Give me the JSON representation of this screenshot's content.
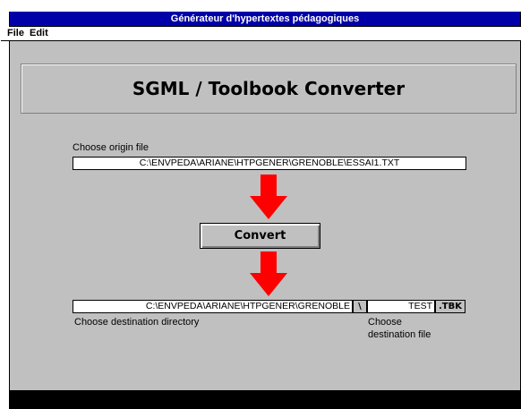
{
  "window": {
    "title": "Générateur d'hypertextes pédagogiques"
  },
  "menu": {
    "file": "File",
    "edit": "Edit"
  },
  "header": {
    "title": "SGML / Toolbook Converter"
  },
  "origin": {
    "label": "Choose origin file",
    "value": "C:\\ENVPEDA\\ARIANE\\HTPGENER\\GRENOBLE\\ESSAI1.TXT"
  },
  "convert": {
    "label": "Convert"
  },
  "destination": {
    "directory_value": "C:\\ENVPEDA\\ARIANE\\HTPGENER\\GRENOBLE",
    "separator": "\\",
    "file_value": "TEST",
    "extension": ".TBK",
    "directory_label": "Choose destination directory",
    "file_label_line1": "Choose",
    "file_label_line2": "destination file"
  },
  "colors": {
    "titlebar": "#0000a8",
    "arrow": "#ff0000",
    "window_bg": "#c0c0c0"
  },
  "icons": {
    "arrow": "red-down-arrow-icon"
  }
}
